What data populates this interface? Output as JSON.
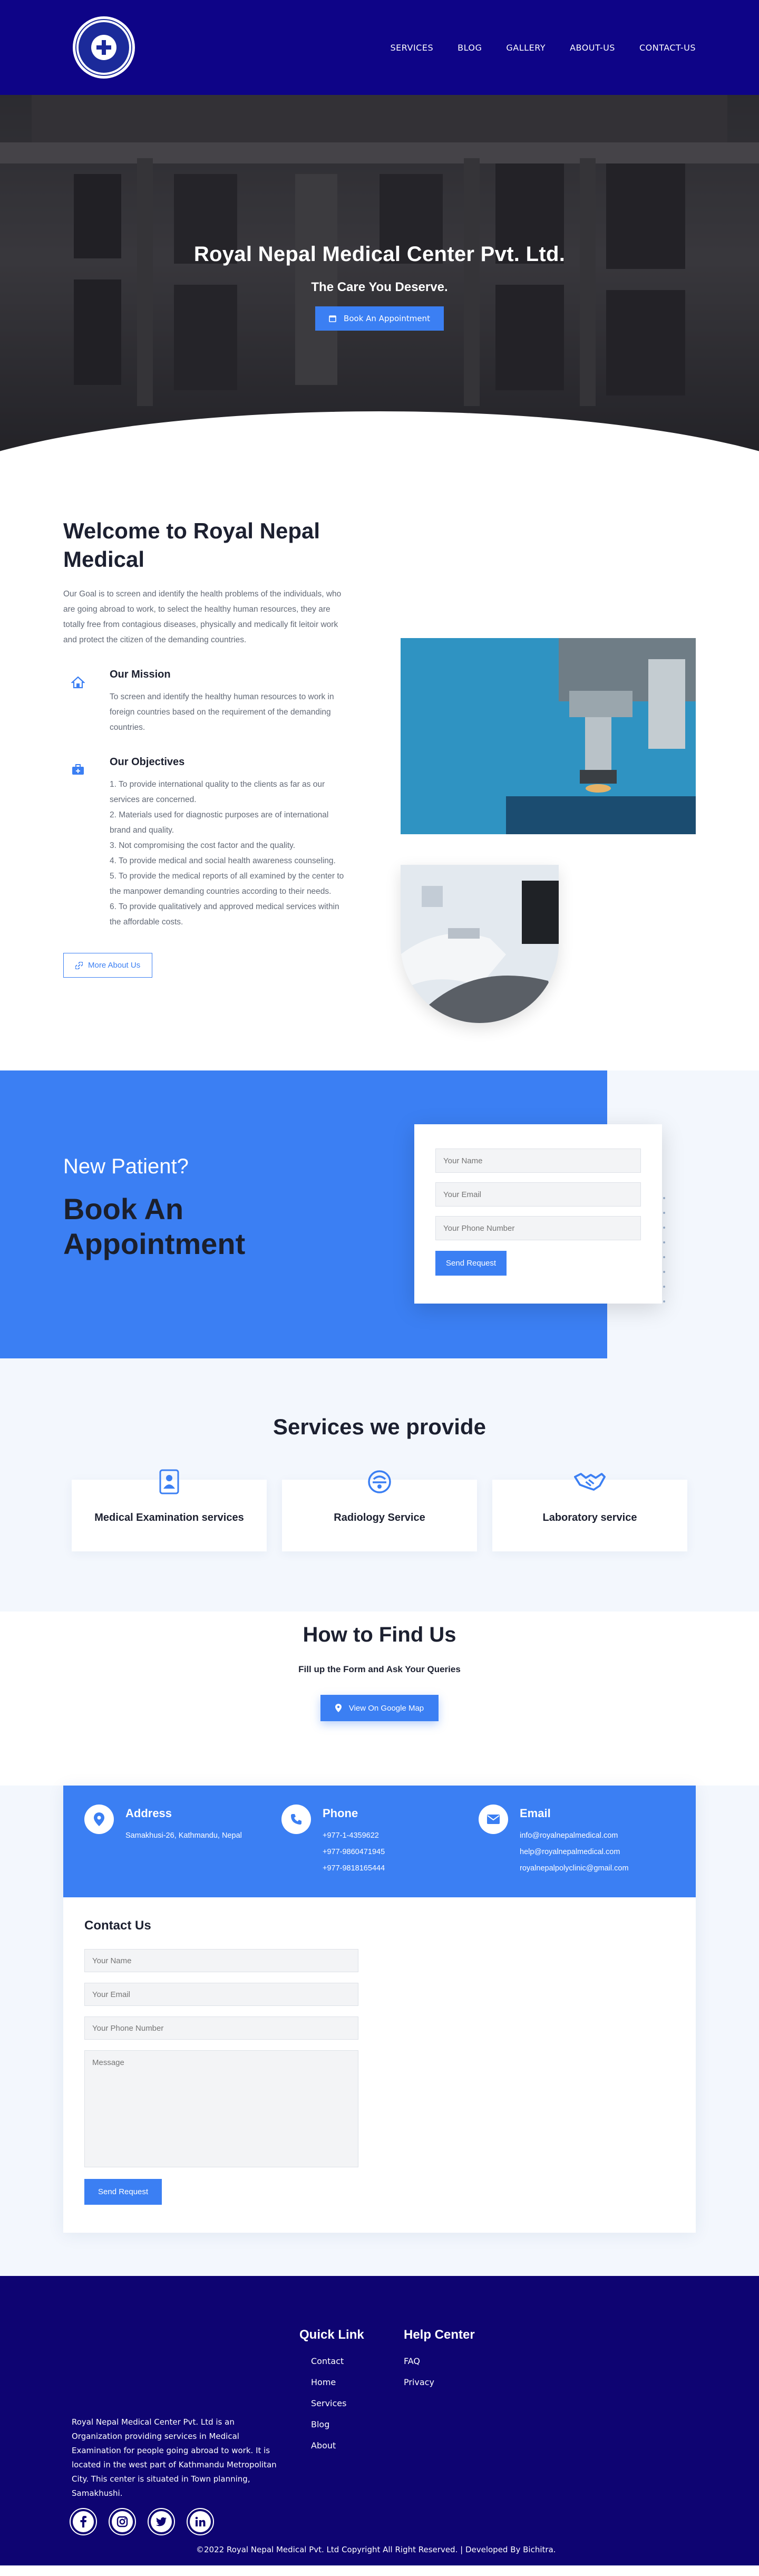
{
  "nav": {
    "links": [
      "SERVICES",
      "BLOG",
      "GALLERY",
      "ABOUT-US",
      "CONTACT-US"
    ]
  },
  "hero": {
    "title": "Royal Nepal Medical Center Pvt. Ltd.",
    "subtitle": "The Care You Deserve.",
    "button": "Book An Appointment"
  },
  "welcome": {
    "title": "Welcome to Royal Nepal Medical",
    "text": "Our Goal is to screen and identify the health problems of the individuals, who are going abroad to work, to select the healthy human resources, they are totally free from contagious diseases, physically and medically fit leitoir work and protect the citizen of the demanding countries.",
    "mission_title": "Our Mission",
    "mission_text": "To screen and identify the healthy human resources to work in foreign countries based on the requirement of the demanding countries.",
    "objectives_title": "Our Objectives",
    "objectives": [
      "1. To provide international quality to the clients as far as our services are concerned.",
      "2. Materials used for diagnostic purposes are of international brand and quality.",
      "3. Not compromising the cost factor and the quality.",
      "4. To provide medical and social health awareness counseling.",
      "5. To provide the medical reports of all examined by the center to the manpower demanding countries according to their needs.",
      "6. To provide qualitatively and approved medical services within the affordable costs."
    ],
    "more_button": "More About Us"
  },
  "appointment": {
    "subtitle": "New Patient?",
    "title": "Book An Appointment",
    "name_placeholder": "Your Name",
    "email_placeholder": "Your Email",
    "phone_placeholder": "Your Phone Number",
    "button": "Send Request"
  },
  "services": {
    "title": "Services we provide",
    "items": [
      "Medical Examination services",
      "Radiology Service",
      "Laboratory service"
    ]
  },
  "find": {
    "title": "How to Find Us",
    "subtitle": "Fill up the Form and Ask Your Queries",
    "button": "View On Google Map"
  },
  "contact": {
    "address_title": "Address",
    "address": "Samakhusi-26, Kathmandu, Nepal",
    "phone_title": "Phone",
    "phones": [
      "+977-1-4359622",
      "+977-9860471945",
      "+977-9818165444"
    ],
    "email_title": "Email",
    "emails": [
      "info@royalnepalmedical.com",
      "help@royalnepalmedical.com",
      "royalnepalpolyclinic@gmail.com"
    ],
    "heading": "Contact Us",
    "name_placeholder": "Your Name",
    "email_placeholder": "Your Email",
    "phone_placeholder": "Your Phone Number",
    "message_placeholder": "Message",
    "button": "Send Request"
  },
  "footer": {
    "about": "Royal Nepal Medical Center Pvt. Ltd is an Organization providing services in Medical Examination for people going abroad to work. It is located in the west part of Kathmandu Metropolitan City. This center is situated in Town planning, Samakhushi.",
    "quick_title": "Quick Link",
    "quick_links": [
      "Contact",
      "Home",
      "Services",
      "Blog",
      "About"
    ],
    "help_title": "Help Center",
    "help_links": [
      "FAQ",
      "Privacy"
    ],
    "copyright": "©2022 Royal Nepal Medical Pvt. Ltd Copyright All Right Reserved. | Developed By Bichitra."
  },
  "colors": {
    "navy": "#0e0487",
    "accent": "#3b7ff3",
    "footer": "#0e0472",
    "light_bg": "#f3f7fd"
  }
}
